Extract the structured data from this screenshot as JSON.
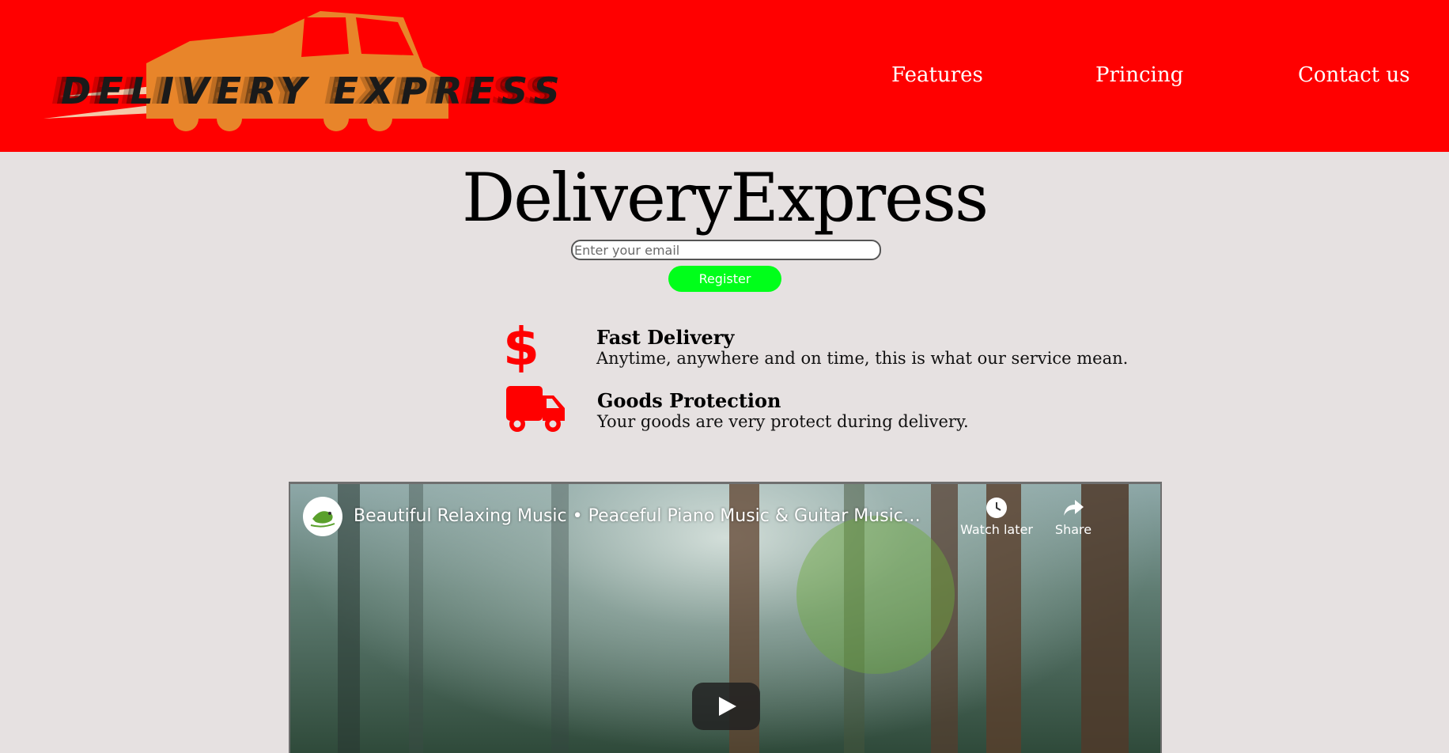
{
  "header": {
    "logo_text": "DELIVERY EXPRESS",
    "nav": [
      {
        "label": "Features"
      },
      {
        "label": "Princing"
      },
      {
        "label": "Contact us"
      }
    ]
  },
  "hero": {
    "title": "DeliveryExpress",
    "email_placeholder": "Enter your email",
    "register_label": "Register"
  },
  "features": [
    {
      "icon": "dollar-icon",
      "title": "Fast Delivery",
      "description": "Anytime, anywhere and on time, this is what our service mean."
    },
    {
      "icon": "truck-icon",
      "title": "Goods Protection",
      "description": "Your goods are very protect during delivery."
    }
  ],
  "video": {
    "title": "Beautiful Relaxing Music • Peaceful Piano Music & Guitar Music | Sunny Mornin...",
    "watch_later_label": "Watch later",
    "share_label": "Share"
  },
  "colors": {
    "header_bg": "#ff0000",
    "logo_truck": "#e8852a",
    "register_btn": "#00ff1a",
    "icon_red": "#ff0000",
    "page_bg": "#e6e1e1"
  }
}
